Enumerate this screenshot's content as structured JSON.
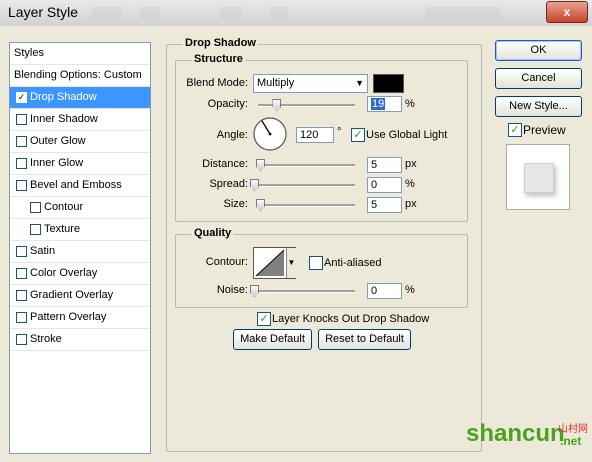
{
  "window": {
    "title": "Layer Style",
    "close_label": "x"
  },
  "sidebar": {
    "header": "Styles",
    "blending_options": "Blending Options: Custom",
    "items": [
      {
        "label": "Drop Shadow",
        "checked": true,
        "selected": true,
        "indent": false
      },
      {
        "label": "Inner Shadow",
        "checked": false,
        "selected": false,
        "indent": false
      },
      {
        "label": "Outer Glow",
        "checked": false,
        "selected": false,
        "indent": false
      },
      {
        "label": "Inner Glow",
        "checked": false,
        "selected": false,
        "indent": false
      },
      {
        "label": "Bevel and Emboss",
        "checked": false,
        "selected": false,
        "indent": false
      },
      {
        "label": "Contour",
        "checked": false,
        "selected": false,
        "indent": true
      },
      {
        "label": "Texture",
        "checked": false,
        "selected": false,
        "indent": true
      },
      {
        "label": "Satin",
        "checked": false,
        "selected": false,
        "indent": false
      },
      {
        "label": "Color Overlay",
        "checked": false,
        "selected": false,
        "indent": false
      },
      {
        "label": "Gradient Overlay",
        "checked": false,
        "selected": false,
        "indent": false
      },
      {
        "label": "Pattern Overlay",
        "checked": false,
        "selected": false,
        "indent": false
      },
      {
        "label": "Stroke",
        "checked": false,
        "selected": false,
        "indent": false
      }
    ]
  },
  "drop_shadow": {
    "title": "Drop Shadow",
    "structure": {
      "title": "Structure",
      "blend_mode_label": "Blend Mode:",
      "blend_mode_value": "Multiply",
      "shadow_color": "#000000",
      "opacity_label": "Opacity:",
      "opacity_value": "19",
      "opacity_unit": "%",
      "opacity_level": 0.19,
      "angle_label": "Angle:",
      "angle_value": "120",
      "angle_unit": "°",
      "use_global_light_label": "Use Global Light",
      "use_global_light_checked": true,
      "distance_label": "Distance:",
      "distance_value": "5",
      "distance_unit": "px",
      "distance_level": 0.02,
      "spread_label": "Spread:",
      "spread_value": "0",
      "spread_unit": "%",
      "spread_level": 0.0,
      "size_label": "Size:",
      "size_value": "5",
      "size_unit": "px",
      "size_level": 0.02
    },
    "quality": {
      "title": "Quality",
      "contour_label": "Contour:",
      "anti_aliased_label": "Anti-aliased",
      "anti_aliased_checked": false,
      "noise_label": "Noise:",
      "noise_value": "0",
      "noise_unit": "%",
      "noise_level": 0.0
    },
    "knocks_out_label": "Layer Knocks Out Drop Shadow",
    "knocks_out_checked": true,
    "make_default_label": "Make Default",
    "reset_default_label": "Reset to Default"
  },
  "actions": {
    "ok_label": "OK",
    "cancel_label": "Cancel",
    "new_style_label": "New Style...",
    "preview_label": "Preview",
    "preview_checked": true
  },
  "watermark": {
    "text_main": "shancun",
    "text_sub": ".net",
    "text_cn": "山村网"
  },
  "colors": {
    "selection": "#3d95ff",
    "dialog_bg": "#ece9d8"
  }
}
